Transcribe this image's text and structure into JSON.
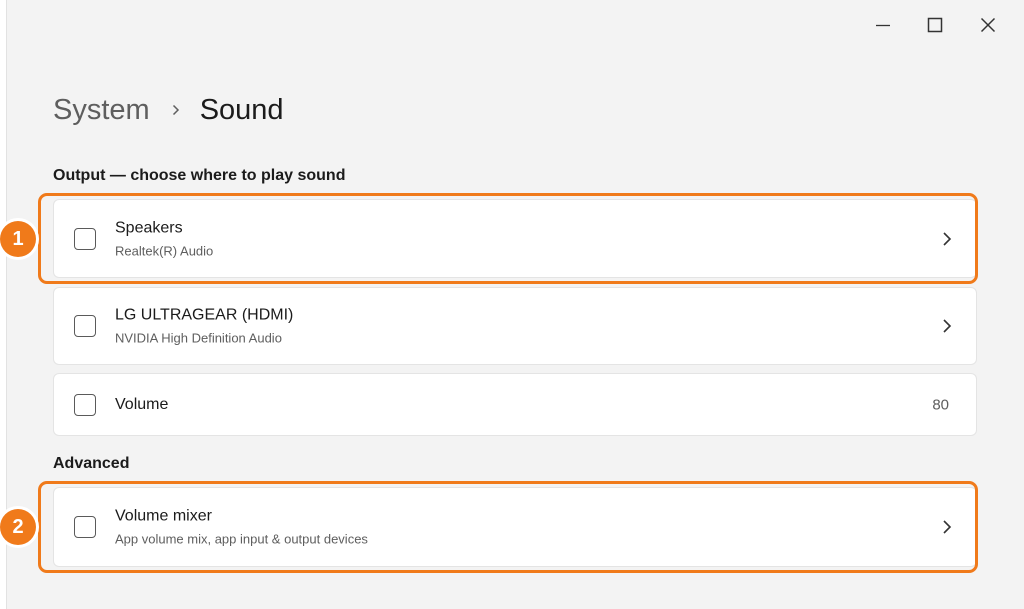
{
  "window_controls": {
    "minimize_icon": "minimize-icon",
    "maximize_icon": "maximize-icon",
    "close_icon": "close-icon"
  },
  "breadcrumb": {
    "parent": "System",
    "separator_icon": "chevron-right-icon",
    "current": "Sound"
  },
  "output": {
    "label": "Output — choose where to play sound",
    "items": [
      {
        "title": "Speakers",
        "subtitle": "Realtek(R) Audio",
        "icon": "checkbox-icon",
        "trailing_icon": "chevron-right-icon"
      },
      {
        "title": "LG ULTRAGEAR (HDMI)",
        "subtitle": "NVIDIA High Definition Audio",
        "icon": "checkbox-icon",
        "trailing_icon": "chevron-right-icon"
      },
      {
        "title": "Volume",
        "value": "80",
        "icon": "checkbox-icon"
      }
    ]
  },
  "advanced": {
    "label": "Advanced",
    "items": [
      {
        "title": "Volume mixer",
        "subtitle": "App volume mix, app input & output devices",
        "icon": "checkbox-icon",
        "trailing_icon": "chevron-right-icon"
      }
    ]
  },
  "annotations": {
    "badge_1": "1",
    "badge_2": "2",
    "highlight_color": "#f07a1a"
  },
  "colors": {
    "window_background": "#f3f3f3",
    "card_background": "#ffffff",
    "primary_text": "#1b1b1b",
    "secondary_text": "#5e5e5e"
  }
}
